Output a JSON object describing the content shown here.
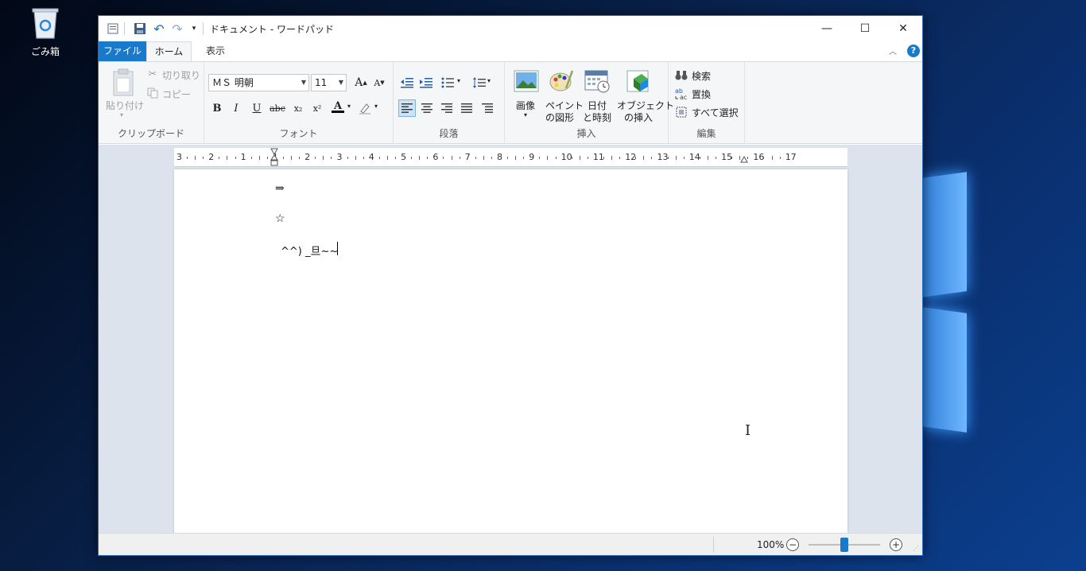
{
  "desktop": {
    "recycle_bin_label": "ごみ箱"
  },
  "window": {
    "title": "ドキュメント - ワードパッド",
    "qat": {
      "icons": [
        "wordpad-app-icon",
        "save-icon",
        "undo-icon",
        "redo-icon",
        "customize-qat-icon"
      ]
    },
    "caption": {
      "minimize": "—",
      "maximize": "☐",
      "close": "✕"
    }
  },
  "tabs": {
    "file": "ファイル",
    "home": "ホーム",
    "view": "表示"
  },
  "ribbon": {
    "clipboard": {
      "label": "クリップボード",
      "paste": "貼り付け",
      "cut": "切り取り",
      "copy": "コピー"
    },
    "font": {
      "label": "フォント",
      "family": "ＭＳ 明朝",
      "size": "11",
      "bold": "B",
      "italic": "I",
      "underline": "U",
      "strikethrough": "abc",
      "subscript": "x₂",
      "superscript": "x²",
      "font_color": "A",
      "grow": "A",
      "shrink": "A"
    },
    "paragraph": {
      "label": "段落"
    },
    "insert": {
      "label": "挿入",
      "picture": "画像",
      "paint": [
        "ペイント",
        "の図形"
      ],
      "datetime": [
        "日付",
        "と時刻"
      ],
      "object": [
        "オブジェクト",
        "の挿入"
      ]
    },
    "editing": {
      "label": "編集",
      "find": "検索",
      "replace": "置換",
      "select_all": "すべて選択"
    }
  },
  "ruler": {
    "labels": [
      "3",
      "2",
      "1",
      "1",
      "2",
      "3",
      "4",
      "5",
      "6",
      "7",
      "8",
      "9",
      "10",
      "11",
      "12",
      "13",
      "14",
      "15",
      "16",
      "17"
    ]
  },
  "document": {
    "lines": [
      "⇒",
      "☆",
      "^^) _旦~~"
    ]
  },
  "status": {
    "zoom": "100%",
    "zoom_level": 0.5
  },
  "colors": {
    "accent": "#1979ca",
    "ribbon_bg": "#f5f6f7",
    "doc_bg": "#dce3ec"
  }
}
